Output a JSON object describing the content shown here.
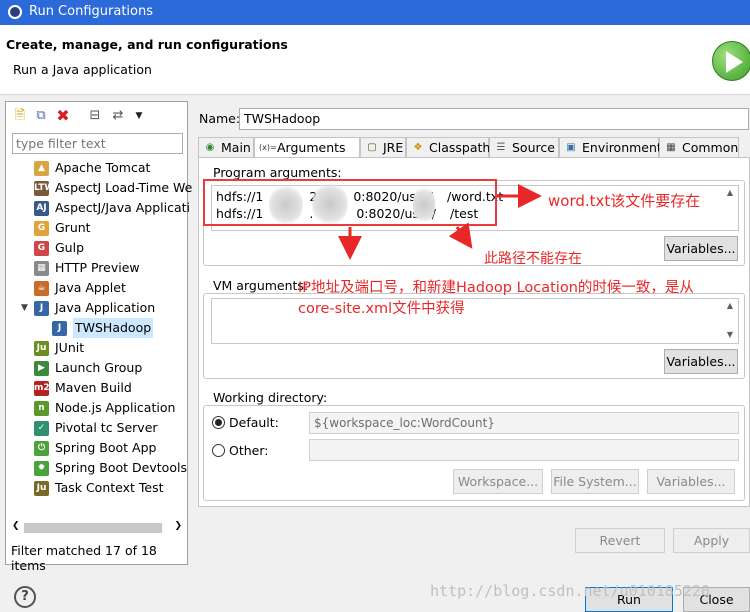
{
  "window": {
    "title": "Run Configurations"
  },
  "header": {
    "title": "Create, manage, and run configurations",
    "subtitle": "Run a Java application",
    "icon": "run-icon"
  },
  "left": {
    "filter_placeholder": "type filter text",
    "items": [
      {
        "label": "Apache Tomcat",
        "icon": "tomcat-icon"
      },
      {
        "label": "AspectJ Load-Time We",
        "icon": "aspectj-ltw-icon"
      },
      {
        "label": "AspectJ/Java Applicati",
        "icon": "aspectj-icon"
      },
      {
        "label": "Grunt",
        "icon": "grunt-icon"
      },
      {
        "label": "Gulp",
        "icon": "gulp-icon"
      },
      {
        "label": "HTTP Preview",
        "icon": "http-preview-icon"
      },
      {
        "label": "Java Applet",
        "icon": "java-applet-icon"
      },
      {
        "label": "Java Application",
        "icon": "java-application-icon"
      },
      {
        "label": "TWSHadoop",
        "icon": "java-config-icon"
      },
      {
        "label": "JUnit",
        "icon": "junit-icon"
      },
      {
        "label": "Launch Group",
        "icon": "launch-group-icon"
      },
      {
        "label": "Maven Build",
        "icon": "maven-icon"
      },
      {
        "label": "Node.js Application",
        "icon": "nodejs-icon"
      },
      {
        "label": "Pivotal tc Server",
        "icon": "pivotal-icon"
      },
      {
        "label": "Spring Boot App",
        "icon": "spring-boot-icon"
      },
      {
        "label": "Spring Boot Devtools",
        "icon": "spring-devtools-icon"
      },
      {
        "label": "Task Context Test",
        "icon": "task-context-icon"
      }
    ],
    "status": "Filter matched 17 of 18 items"
  },
  "config": {
    "name_label": "Name:",
    "name_value": "TWSHadoop",
    "tabs": [
      {
        "label": "Main"
      },
      {
        "label": "Arguments"
      },
      {
        "label": "JRE"
      },
      {
        "label": "Classpath"
      },
      {
        "label": "Source"
      },
      {
        "label": "Environment"
      },
      {
        "label": "Common"
      }
    ],
    "program_args_label": "Program arguments:",
    "args_line1_a": "hdfs://1",
    "args_line1_b": "2",
    "args_line1_c": "0:8020/user/",
    "args_line1_d": "/word.txt",
    "args_line2_a": "hdfs://1",
    "args_line2_b": ".",
    "args_line2_c": "0:8020/user/",
    "args_line2_d": "/test",
    "variables_label": "Variables...",
    "vm_args_label": "VM arguments:",
    "working_dir_label": "Working directory:",
    "default_label": "Default:",
    "default_value": "${workspace_loc:WordCount}",
    "other_label": "Other:",
    "workspace_btn": "Workspace...",
    "filesystem_btn": "File System...",
    "revert_btn": "Revert",
    "apply_btn": "Apply"
  },
  "annotations": {
    "note1": "word.txt该文件要存在",
    "note2": "此路径不能存在",
    "note3_line1": "IP地址及端口号，和新建Hadoop Location的时候一致，是从",
    "note3_line2": "core-site.xml文件中获得"
  },
  "footer": {
    "run_btn": "Run",
    "close_btn": "Close",
    "watermark": "http://blog.csdn.net/u010185220"
  },
  "colors": {
    "accent": "#2b6ad8",
    "annotation": "#e82828",
    "selection": "#cce8ff"
  }
}
